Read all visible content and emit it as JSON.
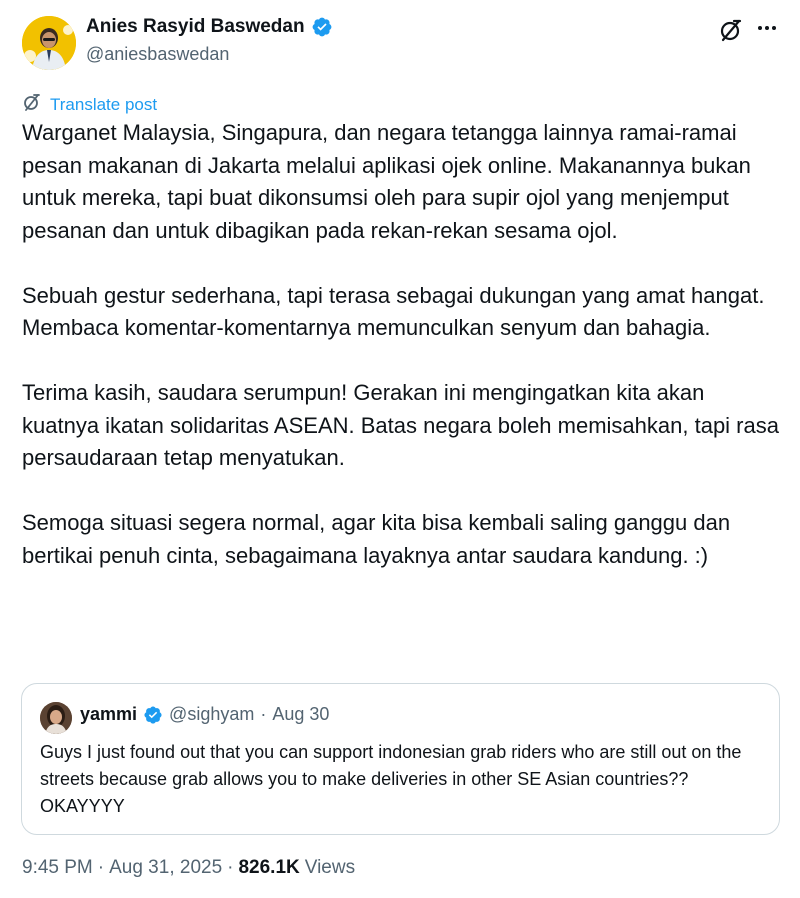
{
  "author": {
    "name": "Anies Rasyid Baswedan",
    "handle": "@aniesbaswedan"
  },
  "translate_label": "Translate post",
  "post": {
    "paragraphs": [
      "Warganet Malaysia, Singapura, dan negara tetangga lainnya ramai-ramai pesan makanan di Jakarta melalui aplikasi ojek online. Makanannya bukan untuk mereka, tapi buat dikonsumsi oleh para supir ojol yang menjemput pesanan dan untuk dibagikan pada rekan-rekan sesama ojol.",
      "Sebuah gestur sederhana, tapi terasa sebagai dukungan yang amat hangat. Membaca komentar-komentarnya memunculkan senyum dan bahagia.",
      "Terima kasih, saudara serumpun! Gerakan ini mengingatkan kita akan kuatnya ikatan solidaritas ASEAN. Batas negara boleh memisahkan, tapi rasa persaudaraan tetap menyatukan.",
      "Semoga situasi segera normal, agar kita bisa kembali saling ganggu dan bertikai penuh cinta, sebagaimana layaknya antar saudara kandung. :)"
    ]
  },
  "quote": {
    "name": "yammi",
    "handle": "@sighyam",
    "separator": "·",
    "date": "Aug 30",
    "text": "Guys I just found out that you can support indonesian grab riders who are still out on the streets because grab allows you to make deliveries in other SE Asian countries?? OKAYYYY"
  },
  "footer": {
    "time": "9:45 PM",
    "sep1": "·",
    "date": "Aug 31, 2025",
    "sep2": "·",
    "views_count": "826.1K",
    "views_label": "Views"
  },
  "colors": {
    "accent": "#1d9bf0",
    "text": "#0f1419",
    "muted": "#536471",
    "border": "#cfd9de"
  },
  "icons": [
    "verified-badge-icon",
    "grok-icon",
    "more-icon",
    "translate-icon"
  ]
}
